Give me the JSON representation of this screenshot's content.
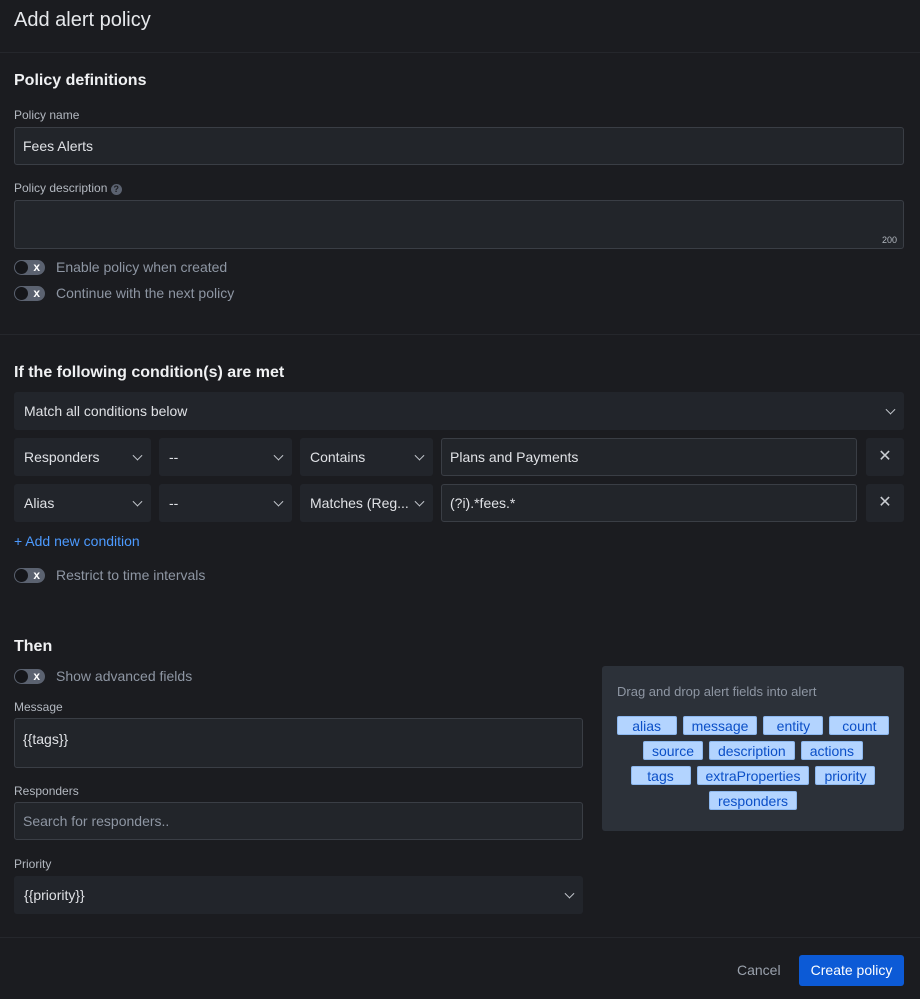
{
  "title": "Add alert policy",
  "definitions": {
    "heading": "Policy definitions",
    "name_label": "Policy name",
    "name_value": "Fees Alerts",
    "desc_label": "Policy description",
    "desc_value": "",
    "desc_counter": "200",
    "enable_label": "Enable policy when created",
    "continue_label": "Continue with the next policy",
    "toggle_icon": "x"
  },
  "conditions": {
    "heading": "If the following condition(s) are met",
    "match": "Match all conditions below",
    "rows": [
      {
        "field": "Responders",
        "not": "--",
        "op": "Contains",
        "value": "Plans and Payments"
      },
      {
        "field": "Alias",
        "not": "--",
        "op": "Matches (Reg...",
        "value": "(?i).*fees.*"
      }
    ],
    "remove_icon": "✕",
    "add": "+ Add new condition",
    "restrict_label": "Restrict to time intervals"
  },
  "then": {
    "heading": "Then",
    "advanced_label": "Show advanced fields",
    "message_label": "Message",
    "message_value": "{{tags}}",
    "responders_label": "Responders",
    "responders_placeholder": "Search for responders..",
    "priority_label": "Priority",
    "priority_value": "{{priority}}"
  },
  "panel": {
    "title": "Drag and drop alert fields into alert",
    "tags": [
      "alias",
      "message",
      "entity",
      "count",
      "source",
      "description",
      "actions",
      "tags",
      "extraProperties",
      "priority",
      "responders"
    ]
  },
  "footer": {
    "cancel": "Cancel",
    "create": "Create policy"
  },
  "colors": {
    "primary": "#0c5ad6",
    "link": "#4c9aff"
  }
}
